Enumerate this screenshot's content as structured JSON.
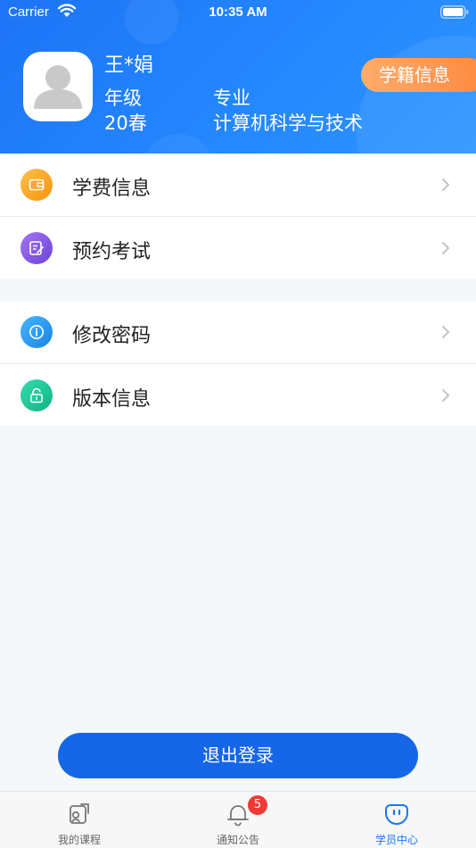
{
  "status_bar": {
    "carrier": "Carrier",
    "time": "10:35 AM"
  },
  "profile": {
    "name": "王*娟",
    "grade_label": "年级",
    "grade_value": "20春",
    "major_label": "专业",
    "major_value": "计算机科学与技术",
    "status_button": "学籍信息"
  },
  "menu": {
    "group1": [
      {
        "label": "学费信息",
        "icon": "wallet-icon",
        "color": "#fba21b"
      },
      {
        "label": "预约考试",
        "icon": "edit-note-icon",
        "color": "#8a5ae8"
      }
    ],
    "group2": [
      {
        "label": "修改密码",
        "icon": "info-icon",
        "color": "#2a9bf0"
      },
      {
        "label": "版本信息",
        "icon": "lock-icon",
        "color": "#1ec597"
      }
    ]
  },
  "logout_label": "退出登录",
  "tabs": [
    {
      "label": "我的课程",
      "icon": "courses-icon"
    },
    {
      "label": "通知公告",
      "icon": "bell-icon",
      "badge": "5"
    },
    {
      "label": "学员中心",
      "icon": "student-center-icon",
      "active": true
    }
  ],
  "colors": {
    "header": "#1f7cf7",
    "accent": "#1666e8",
    "pill": "#ff8a40",
    "badge": "#ee3a34"
  }
}
